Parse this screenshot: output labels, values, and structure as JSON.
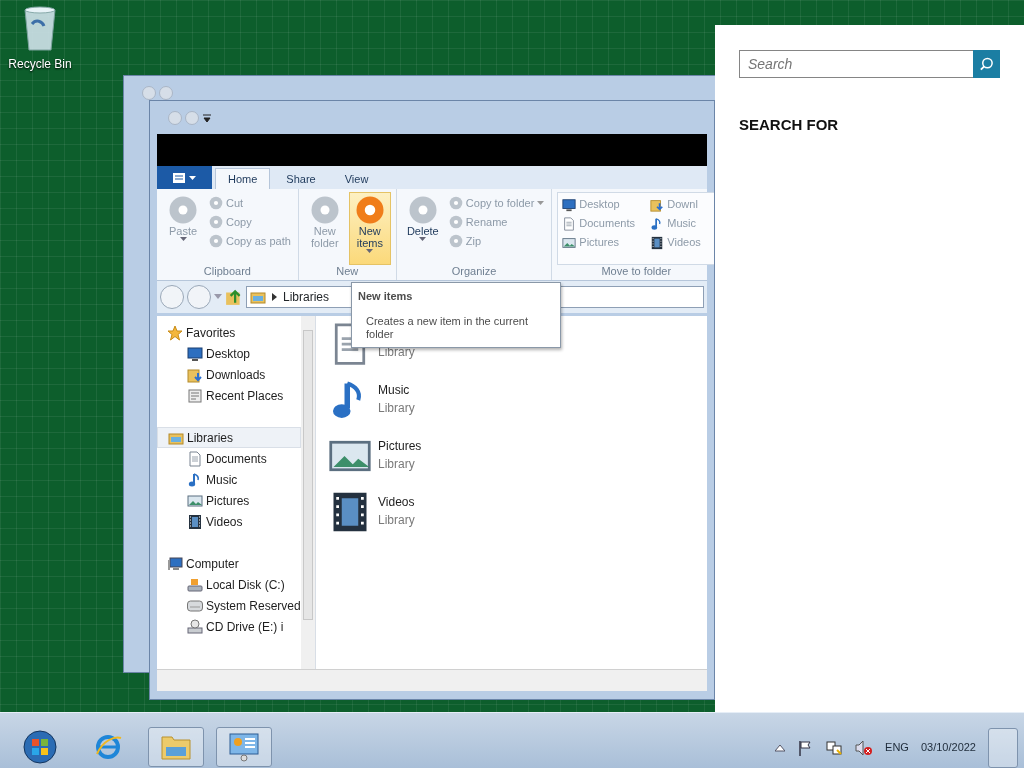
{
  "desktop": {
    "icons": [
      {
        "label": "Recycle Bin"
      }
    ]
  },
  "explorer": {
    "file_tab": {
      "kind": "menu"
    },
    "ribbon_tabs": [
      {
        "label": "Home",
        "selected": true
      },
      {
        "label": "Share",
        "selected": false
      },
      {
        "label": "View",
        "selected": false
      }
    ],
    "ribbon_groups": [
      {
        "label": "Clipboard",
        "large": [
          {
            "label": "Paste",
            "disabled": true,
            "dropdown": true,
            "hovered": false
          }
        ],
        "small": [
          {
            "label": "Cut",
            "disabled": true,
            "dropdown": false
          },
          {
            "label": "Copy",
            "disabled": true,
            "dropdown": false
          },
          {
            "label": "Copy as path",
            "disabled": true,
            "dropdown": false
          }
        ]
      },
      {
        "label": "New",
        "large": [
          {
            "label": "New folder",
            "disabled": true,
            "dropdown": false,
            "hovered": false
          },
          {
            "label": "New items",
            "disabled": false,
            "dropdown": true,
            "hovered": true
          }
        ]
      },
      {
        "label": "Organize",
        "large": [
          {
            "label": "Delete",
            "disabled": false,
            "dropdown": true,
            "hovered": false
          }
        ],
        "small": [
          {
            "label": "Copy to folder",
            "disabled": true,
            "dropdown": true
          },
          {
            "label": "Rename",
            "disabled": true,
            "dropdown": false
          },
          {
            "label": "Zip",
            "disabled": true,
            "dropdown": false
          }
        ]
      },
      {
        "label": "Move to folder",
        "gallery": [
          {
            "label": "Desktop",
            "kind": "monitor"
          },
          {
            "label": "Downl",
            "kind": "download"
          },
          {
            "label": "Documents",
            "kind": "document"
          },
          {
            "label": "Music",
            "kind": "music"
          },
          {
            "label": "Pictures",
            "kind": "picture"
          },
          {
            "label": "Videos",
            "kind": "video"
          }
        ]
      }
    ],
    "address": {
      "crumbs": [
        "Libraries"
      ]
    },
    "tooltip": {
      "title": "New items",
      "text": "Creates a new item in the current folder"
    },
    "nav_pane": [
      {
        "label": "Favorites",
        "kind": "star",
        "selected": false,
        "children": [
          {
            "label": "Desktop",
            "kind": "monitor"
          },
          {
            "label": "Downloads",
            "kind": "download"
          },
          {
            "label": "Recent Places",
            "kind": "recent"
          }
        ]
      },
      {
        "label": "Libraries",
        "kind": "library",
        "selected": true,
        "children": [
          {
            "label": "Documents",
            "kind": "document"
          },
          {
            "label": "Music",
            "kind": "music"
          },
          {
            "label": "Pictures",
            "kind": "picture"
          },
          {
            "label": "Videos",
            "kind": "video"
          }
        ]
      },
      {
        "label": "Computer",
        "kind": "computer",
        "selected": false,
        "children": [
          {
            "label": "Local Disk (C:)",
            "kind": "disk"
          },
          {
            "label": "System Reserved",
            "kind": "drive"
          },
          {
            "label": "CD Drive (E:) i",
            "kind": "cd"
          }
        ]
      }
    ],
    "libraries": [
      {
        "subtitle": "Library",
        "kind": "document"
      },
      {
        "name": "Music",
        "subtitle": "Library",
        "kind": "music"
      },
      {
        "name": "Pictures",
        "subtitle": "Library",
        "kind": "picture"
      },
      {
        "name": "Videos",
        "subtitle": "Library",
        "kind": "video"
      }
    ]
  },
  "search_charm": {
    "placeholder": "Search",
    "heading": "SEARCH FOR"
  },
  "taskbar": {
    "items": [
      {
        "kind": "start",
        "active": false
      },
      {
        "kind": "browser",
        "active": false
      },
      {
        "kind": "explorer",
        "active": true
      },
      {
        "kind": "panel",
        "active": true
      }
    ],
    "tray": {
      "language": "ENG",
      "date": "03/10/2022"
    }
  }
}
